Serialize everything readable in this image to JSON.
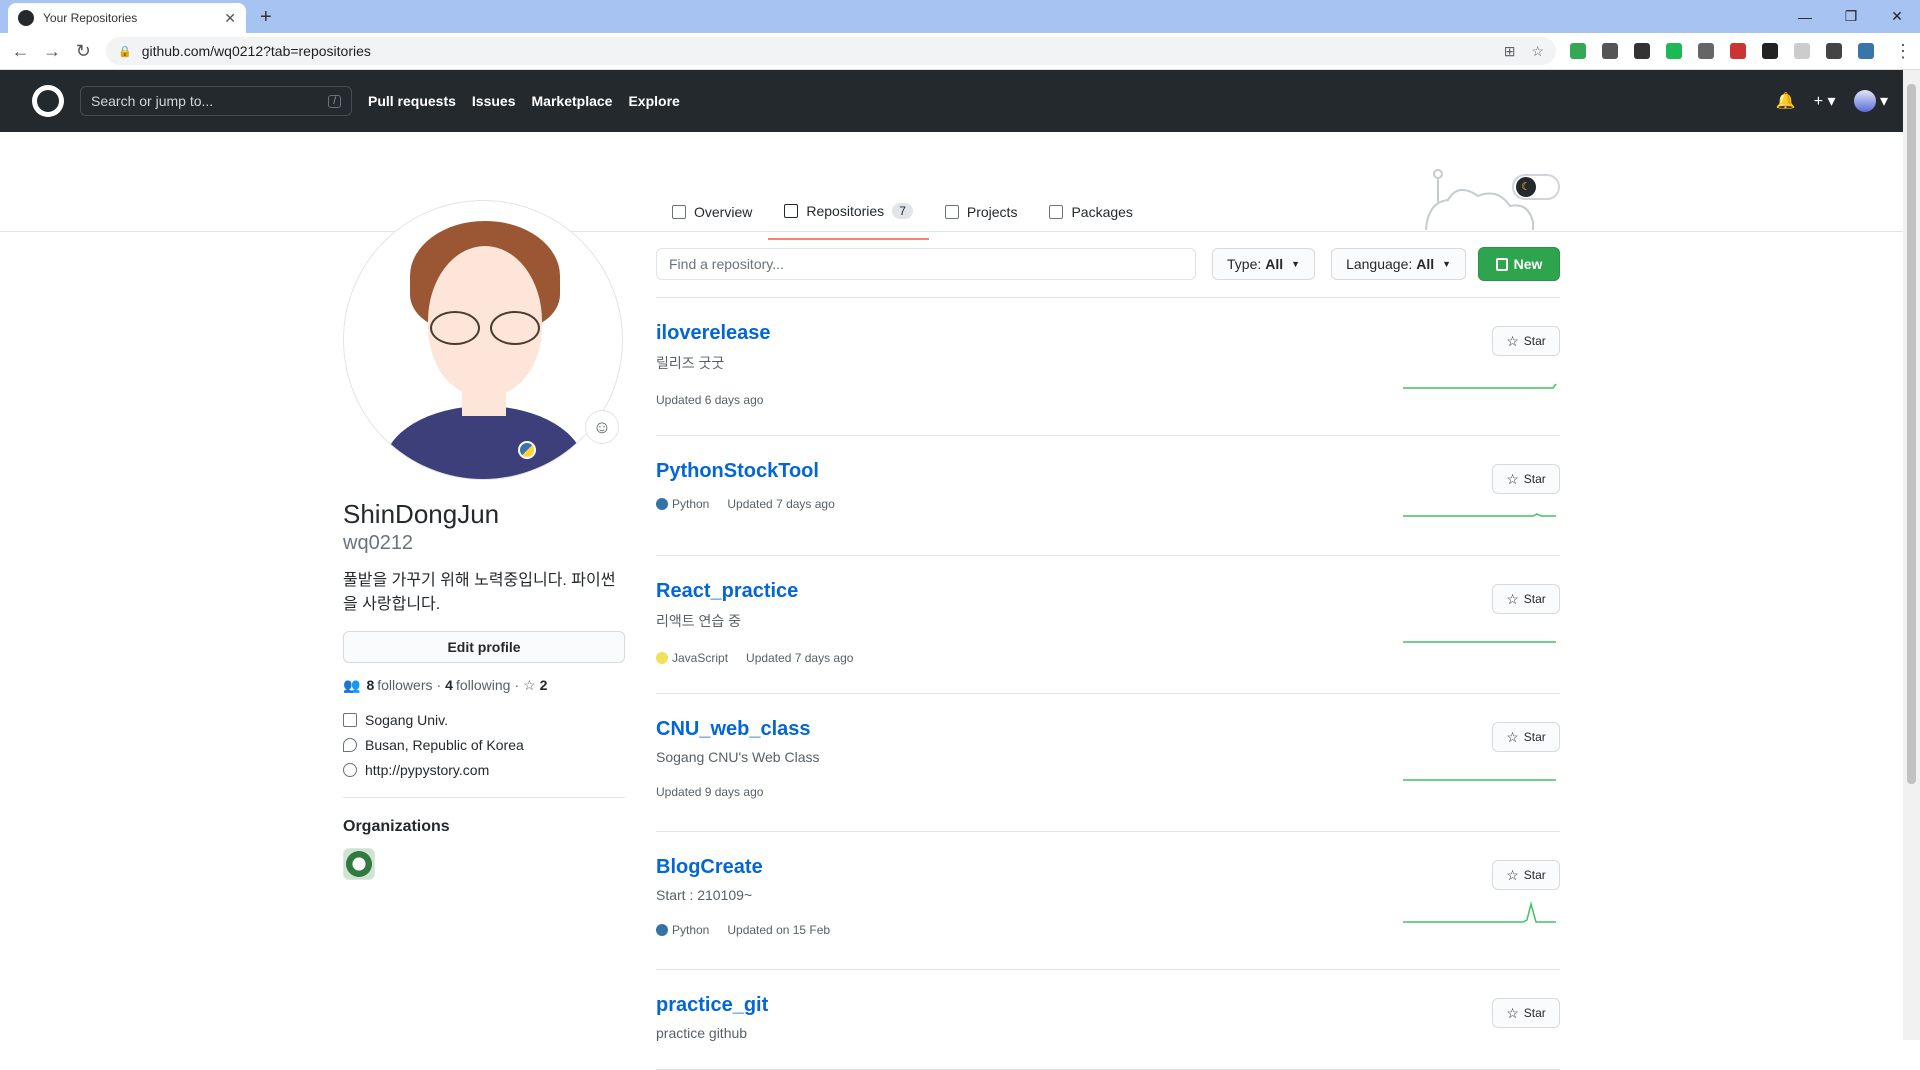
{
  "browser": {
    "tab_title": "Your Repositories",
    "url": "github.com/wq0212?tab=repositories"
  },
  "header": {
    "search_placeholder": "Search or jump to...",
    "search_key": "/",
    "nav": [
      "Pull requests",
      "Issues",
      "Marketplace",
      "Explore"
    ]
  },
  "tabs": [
    {
      "label": "Overview",
      "icon": "book-icon"
    },
    {
      "label": "Repositories",
      "icon": "repo-icon",
      "count": "7",
      "active": true
    },
    {
      "label": "Projects",
      "icon": "project-icon"
    },
    {
      "label": "Packages",
      "icon": "package-icon"
    }
  ],
  "profile": {
    "name": "ShinDongJun",
    "login": "wq0212",
    "bio": "풀밭을 가꾸기 위해 노력중입니다. 파이썬을 사랑합니다.",
    "edit_label": "Edit profile",
    "followers_count": "8",
    "followers_label": "followers",
    "following_count": "4",
    "following_label": "following",
    "stars_count": "2",
    "company": "Sogang Univ.",
    "location": "Busan, Republic of Korea",
    "website": "http://pypystory.com",
    "orgs_heading": "Organizations"
  },
  "filters": {
    "find_placeholder": "Find a repository...",
    "type_label": "Type:",
    "type_value": "All",
    "language_label": "Language:",
    "language_value": "All",
    "new_label": "New"
  },
  "repos": [
    {
      "name": "iloverelease",
      "desc": "릴리즈 굿굿",
      "lang": "",
      "lang_color": "",
      "updated": "Updated 6 days ago",
      "star": "Star"
    },
    {
      "name": "PythonStockTool",
      "desc": "",
      "lang": "Python",
      "lang_color": "#3572A5",
      "updated": "Updated 7 days ago",
      "star": "Star"
    },
    {
      "name": "React_practice",
      "desc": "리액트 연습 중",
      "lang": "JavaScript",
      "lang_color": "#f1e05a",
      "updated": "Updated 7 days ago",
      "star": "Star"
    },
    {
      "name": "CNU_web_class",
      "desc": "Sogang CNU's Web Class",
      "lang": "",
      "lang_color": "",
      "updated": "Updated 9 days ago",
      "star": "Star"
    },
    {
      "name": "BlogCreate",
      "desc": "Start : 210109~",
      "lang": "Python",
      "lang_color": "#3572A5",
      "updated": "Updated on 15 Feb",
      "star": "Star"
    },
    {
      "name": "practice_git",
      "desc": "practice github",
      "lang": "",
      "lang_color": "",
      "updated": "",
      "star": "Star"
    }
  ],
  "colors": {
    "accent": "#0366d6",
    "new_button": "#2ea44f",
    "active_tab": "#f9826c"
  }
}
